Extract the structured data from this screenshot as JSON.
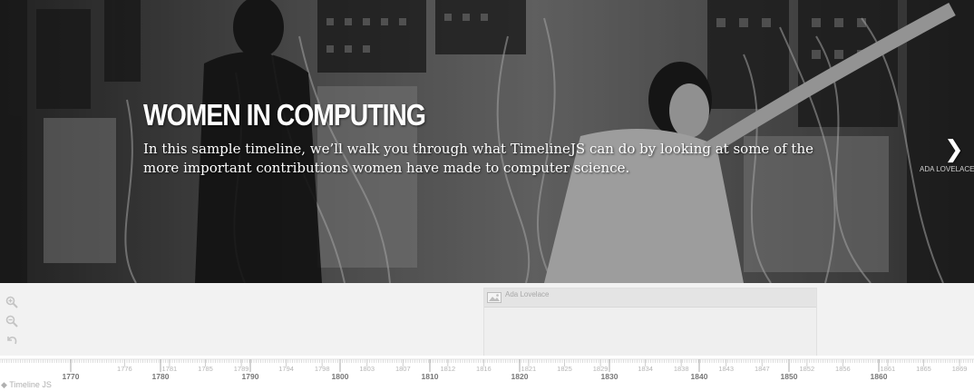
{
  "slide": {
    "headline": "WOMEN IN COMPUTING",
    "text": "In this sample timeline, we’ll walk you through what TimelineJS can do by looking at some of the more important contributions women have made to computer science.",
    "next_label": "ADA LOVELACE",
    "next_icon": "chevron-right-icon"
  },
  "timenav": {
    "zoom_in_icon": "zoom-in-icon",
    "zoom_out_icon": "zoom-out-icon",
    "back_icon": "back-to-start-icon",
    "marker": {
      "title": "Ada Lovelace",
      "icon": "image-icon"
    },
    "credit": "◆ Timeline JS"
  },
  "axis": {
    "major_ticks": [
      "1770",
      "1780",
      "1790",
      "1800",
      "1810",
      "1820",
      "1830",
      "1840",
      "1850",
      "1860"
    ],
    "minor_ticks": [
      "1776",
      "1781",
      "1785",
      "1789",
      "1794",
      "1798",
      "1803",
      "1807",
      "1812",
      "1816",
      "1821",
      "1825",
      "1829",
      "1834",
      "1838",
      "1843",
      "1847",
      "1852",
      "1856",
      "1861",
      "1865",
      "1869"
    ]
  }
}
